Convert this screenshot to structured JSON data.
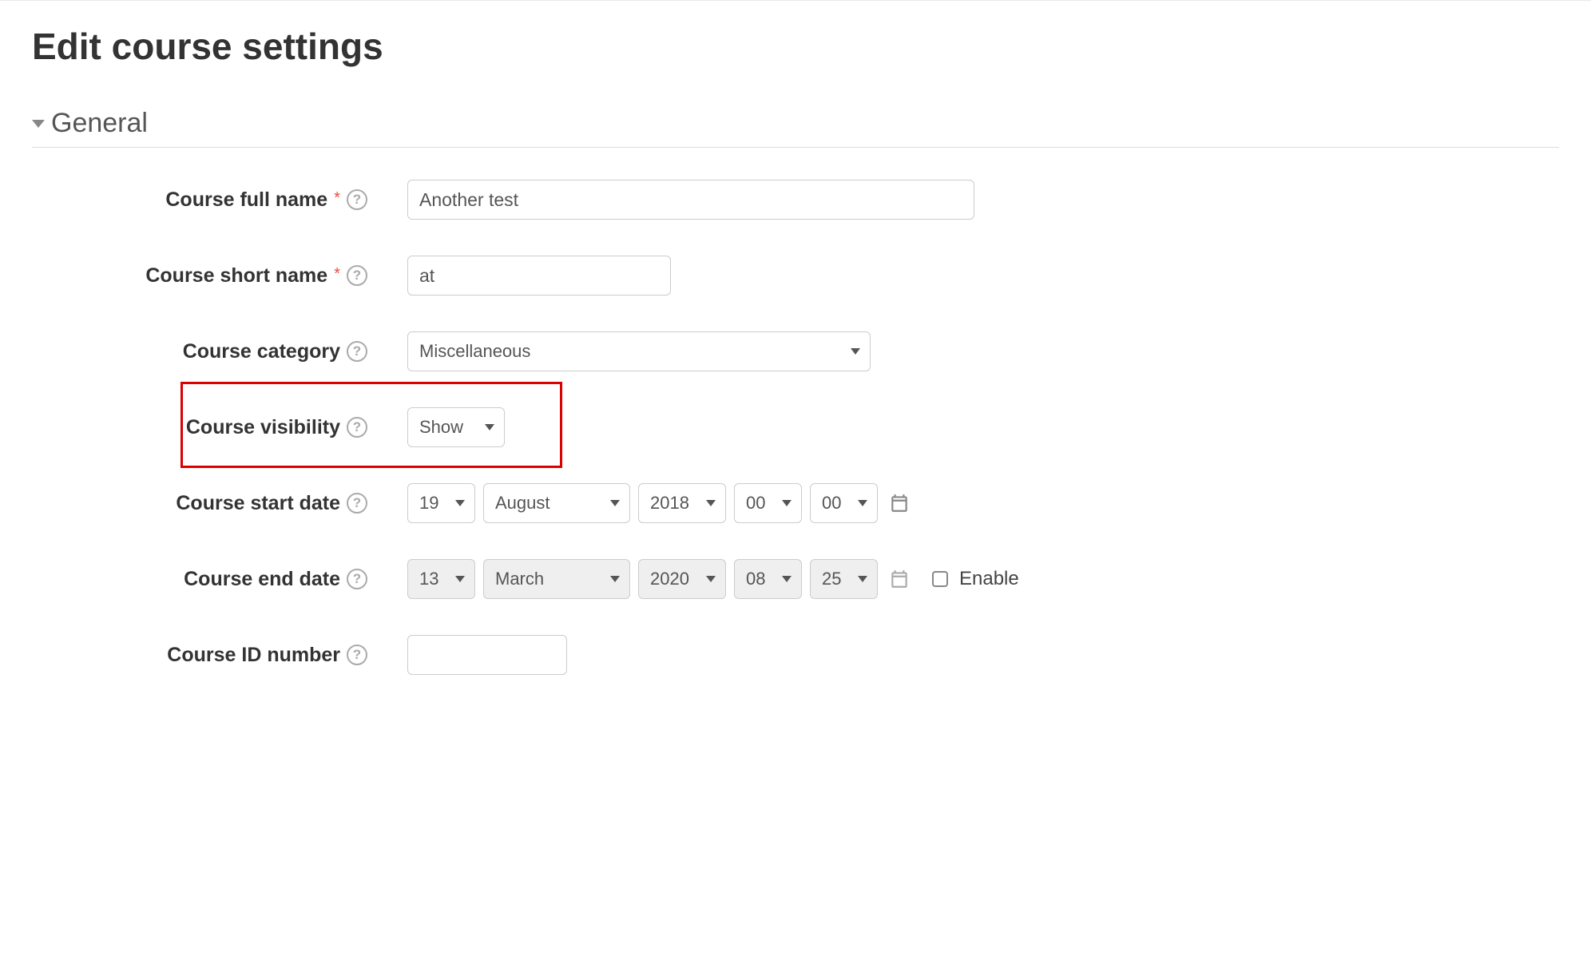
{
  "page": {
    "title": "Edit course settings"
  },
  "section": {
    "title": "General"
  },
  "fields": {
    "fullname": {
      "label": "Course full name",
      "value": "Another test",
      "required": true
    },
    "shortname": {
      "label": "Course short name",
      "value": "at",
      "required": true
    },
    "category": {
      "label": "Course category",
      "value": "Miscellaneous"
    },
    "visibility": {
      "label": "Course visibility",
      "value": "Show"
    },
    "startdate": {
      "label": "Course start date",
      "day": "19",
      "month": "August",
      "year": "2018",
      "hour": "00",
      "minute": "00"
    },
    "enddate": {
      "label": "Course end date",
      "day": "13",
      "month": "March",
      "year": "2020",
      "hour": "08",
      "minute": "25",
      "enable_label": "Enable"
    },
    "idnumber": {
      "label": "Course ID number",
      "value": ""
    },
    "help_glyph": "?"
  }
}
